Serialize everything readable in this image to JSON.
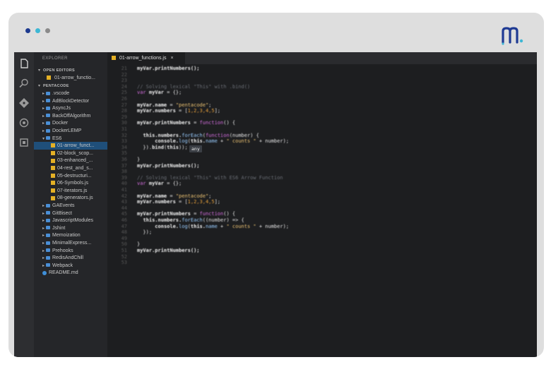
{
  "window": {
    "dots": [
      "#1d3a8f",
      "#3db7d4",
      "#8a8a8a"
    ],
    "frame_color": "#dedede",
    "logo_icon": "brand-m-logo"
  },
  "activity_bar": {
    "icons": [
      "files-icon",
      "search-icon",
      "source-control-icon",
      "debug-icon",
      "extensions-icon"
    ]
  },
  "sidebar": {
    "title": "EXPLORER",
    "open_editors_label": "OPEN EDITORS",
    "open_file": "01-arrow_functio...",
    "project_label": "PENTACODE",
    "tree": [
      {
        "type": "folder",
        "label": ".vscode",
        "depth": 1
      },
      {
        "type": "folder",
        "label": "AdBlockDetector",
        "depth": 1
      },
      {
        "type": "folder",
        "label": "AsyncJs",
        "depth": 1
      },
      {
        "type": "folder",
        "label": "BackOffAlgorithm",
        "depth": 1
      },
      {
        "type": "folder",
        "label": "Docker",
        "depth": 1
      },
      {
        "type": "folder",
        "label": "DockerLEMP",
        "depth": 1
      },
      {
        "type": "folder-open",
        "label": "ES6",
        "depth": 1
      },
      {
        "type": "file",
        "label": "01-arrow_funct...",
        "depth": 2,
        "active": true
      },
      {
        "type": "file",
        "label": "02-block_scop...",
        "depth": 2
      },
      {
        "type": "file",
        "label": "03-enhanced_...",
        "depth": 2
      },
      {
        "type": "file",
        "label": "04-rest_and_s...",
        "depth": 2
      },
      {
        "type": "file",
        "label": "05-destructuri...",
        "depth": 2
      },
      {
        "type": "file",
        "label": "06-Symbols.js",
        "depth": 2
      },
      {
        "type": "file",
        "label": "07-iterators.js",
        "depth": 2
      },
      {
        "type": "file",
        "label": "08-generators.js",
        "depth": 2
      },
      {
        "type": "folder",
        "label": "GAEvents",
        "depth": 1
      },
      {
        "type": "folder",
        "label": "GitBisect",
        "depth": 1
      },
      {
        "type": "folder",
        "label": "JavascriptModules",
        "depth": 1
      },
      {
        "type": "folder",
        "label": "Jshint",
        "depth": 1
      },
      {
        "type": "folder",
        "label": "Memoization",
        "depth": 1
      },
      {
        "type": "folder",
        "label": "MinimalExpress...",
        "depth": 1
      },
      {
        "type": "folder",
        "label": "Prehooks",
        "depth": 1
      },
      {
        "type": "folder",
        "label": "RedisAndChill",
        "depth": 1
      },
      {
        "type": "folder",
        "label": "Webpack",
        "depth": 1
      },
      {
        "type": "md",
        "label": "README.md",
        "depth": 1
      }
    ]
  },
  "editor": {
    "tab_label": "01-arrow_functions.js",
    "tab_close": "×",
    "tooltip": "any",
    "lines": [
      {
        "n": "21",
        "tokens": [
          [
            "fn",
            "myVar.printNumbers();"
          ]
        ]
      },
      {
        "n": "22",
        "tokens": []
      },
      {
        "n": "23",
        "tokens": []
      },
      {
        "n": "24",
        "tokens": [
          [
            "cm",
            "// Solving lexical \"This\" with .bind()"
          ]
        ]
      },
      {
        "n": "25",
        "tokens": [
          [
            "kw",
            "var "
          ],
          [
            "fn",
            "myVar"
          ],
          [
            "def",
            " = {};"
          ]
        ]
      },
      {
        "n": "26",
        "tokens": []
      },
      {
        "n": "27",
        "tokens": [
          [
            "fn",
            "myVar.name"
          ],
          [
            "def",
            " = "
          ],
          [
            "str",
            "\"pentacode\""
          ],
          [
            "def",
            ";"
          ]
        ]
      },
      {
        "n": "28",
        "tokens": [
          [
            "fn",
            "myVar.numbers"
          ],
          [
            "def",
            " = ["
          ],
          [
            "num",
            "1,2,3,4,5"
          ],
          [
            "def",
            "];"
          ]
        ]
      },
      {
        "n": "29",
        "tokens": []
      },
      {
        "n": "30",
        "tokens": [
          [
            "fn",
            "myVar.printNumbers"
          ],
          [
            "def",
            " = "
          ],
          [
            "kw",
            "function"
          ],
          [
            "def",
            "() {"
          ]
        ]
      },
      {
        "n": "31",
        "tokens": []
      },
      {
        "n": "32",
        "tokens": [
          [
            "def",
            "  "
          ],
          [
            "fn",
            "this.numbers."
          ],
          [
            "prop",
            "forEach"
          ],
          [
            "def",
            "("
          ],
          [
            "kw",
            "function"
          ],
          [
            "def",
            "(number) {"
          ]
        ]
      },
      {
        "n": "33",
        "tokens": [
          [
            "def",
            "      "
          ],
          [
            "fn",
            "console."
          ],
          [
            "prop",
            "log"
          ],
          [
            "def",
            "("
          ],
          [
            "fn",
            "this."
          ],
          [
            "prop",
            "name"
          ],
          [
            "def",
            " + "
          ],
          [
            "str",
            "\" counts \""
          ],
          [
            "def",
            " + number);"
          ]
        ]
      },
      {
        "n": "34",
        "tokens": [
          [
            "def",
            "  })."
          ],
          [
            "fn",
            "bind"
          ],
          [
            "def",
            "("
          ],
          [
            "fn",
            "this"
          ],
          [
            "def",
            "));"
          ]
        ]
      },
      {
        "n": "35",
        "tokens": []
      },
      {
        "n": "36",
        "tokens": [
          [
            "def",
            "}"
          ]
        ]
      },
      {
        "n": "37",
        "tokens": [
          [
            "fn",
            "myVar.printNumbers();"
          ]
        ]
      },
      {
        "n": "38",
        "tokens": []
      },
      {
        "n": "39",
        "tokens": [
          [
            "cm",
            "// Solving lexical \"This\" with ES6 Arrow Function"
          ]
        ]
      },
      {
        "n": "40",
        "tokens": [
          [
            "kw",
            "var "
          ],
          [
            "fn",
            "myVar"
          ],
          [
            "def",
            " = {};"
          ]
        ]
      },
      {
        "n": "41",
        "tokens": []
      },
      {
        "n": "42",
        "tokens": [
          [
            "fn",
            "myVar.name"
          ],
          [
            "def",
            " = "
          ],
          [
            "str",
            "\"pentacode\""
          ],
          [
            "def",
            ";"
          ]
        ]
      },
      {
        "n": "43",
        "tokens": [
          [
            "fn",
            "myVar.numbers"
          ],
          [
            "def",
            " = ["
          ],
          [
            "num",
            "1,2,3,4,5"
          ],
          [
            "def",
            "];"
          ]
        ]
      },
      {
        "n": "44",
        "tokens": []
      },
      {
        "n": "45",
        "tokens": [
          [
            "fn",
            "myVar.printNumbers"
          ],
          [
            "def",
            " = "
          ],
          [
            "kw",
            "function"
          ],
          [
            "def",
            "() {"
          ]
        ]
      },
      {
        "n": "46",
        "tokens": [
          [
            "def",
            "  "
          ],
          [
            "fn",
            "this.numbers."
          ],
          [
            "prop",
            "forEach"
          ],
          [
            "def",
            "((number) => {"
          ]
        ]
      },
      {
        "n": "47",
        "tokens": [
          [
            "def",
            "      "
          ],
          [
            "fn",
            "console."
          ],
          [
            "prop",
            "log"
          ],
          [
            "def",
            "("
          ],
          [
            "fn",
            "this."
          ],
          [
            "prop",
            "name"
          ],
          [
            "def",
            " + "
          ],
          [
            "str",
            "\" counts \""
          ],
          [
            "def",
            " + number);"
          ]
        ]
      },
      {
        "n": "48",
        "tokens": [
          [
            "def",
            "  });"
          ]
        ]
      },
      {
        "n": "49",
        "tokens": []
      },
      {
        "n": "50",
        "tokens": [
          [
            "def",
            "}"
          ]
        ]
      },
      {
        "n": "51",
        "tokens": [
          [
            "fn",
            "myVar.printNumbers();"
          ]
        ]
      },
      {
        "n": "52",
        "tokens": []
      },
      {
        "n": "53",
        "tokens": []
      }
    ]
  }
}
